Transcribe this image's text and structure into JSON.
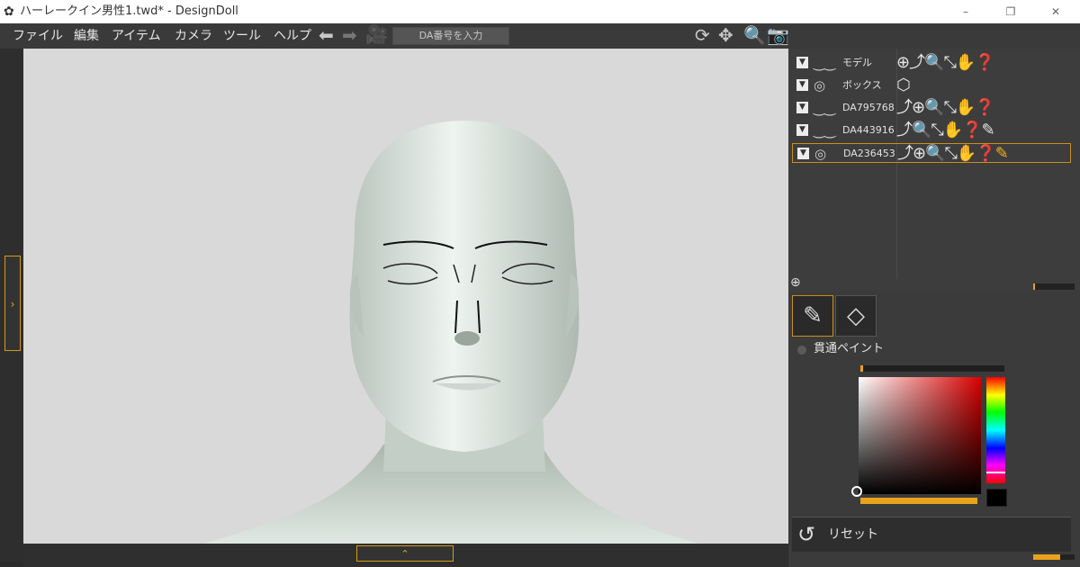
{
  "window": {
    "title": "ハーレークイン男性1.twd* - DesignDoll",
    "app_icon": "designdoll-logo-icon"
  },
  "menu": [
    "ファイル",
    "編集",
    "アイテム",
    "カメラ",
    "ツール",
    "ヘルプ"
  ],
  "toolbar": {
    "da_placeholder": "DA番号を入力"
  },
  "scene": {
    "rows": [
      {
        "name": "モデル",
        "vis_icon": "eye-closed-icon",
        "selected": false
      },
      {
        "name": "ボックス",
        "vis_icon": "spiral-icon",
        "selected": false
      },
      {
        "name": "DA795768",
        "vis_icon": "eye-closed-icon",
        "selected": false
      },
      {
        "name": "DA443916",
        "vis_icon": "eye-closed-icon",
        "selected": false
      },
      {
        "name": "DA236453",
        "vis_icon": "spiral-icon",
        "selected": true
      }
    ]
  },
  "paint": {
    "option_label": "貫通ペイント",
    "tools": [
      "pencil-icon",
      "eraser-icon"
    ],
    "active_tool": "pencil-icon"
  },
  "color": {
    "sat_hue": "#d80000",
    "swatch": "#000000",
    "accent": "#e8a21b"
  },
  "reset": {
    "label": "リセット"
  }
}
